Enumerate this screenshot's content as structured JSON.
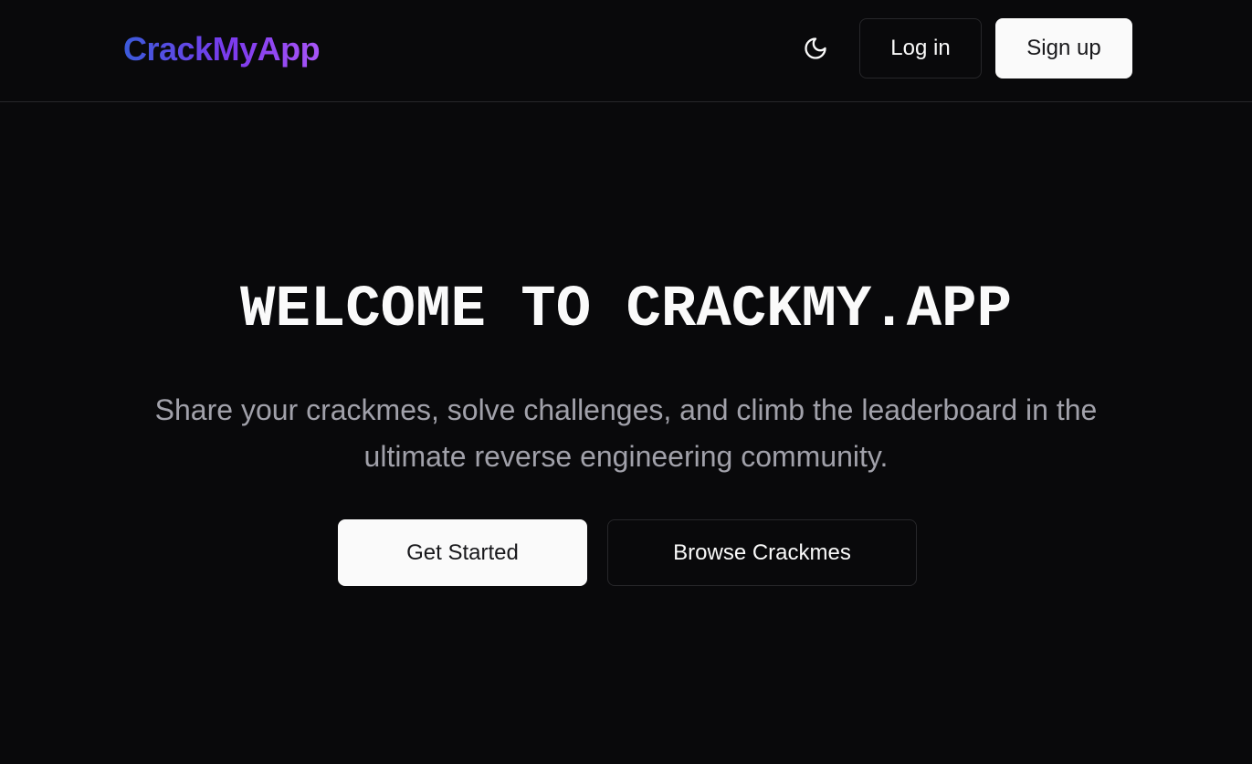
{
  "navbar": {
    "logo_text": "CrackMyApp",
    "theme_toggle_icon": "moon-icon",
    "login_label": "Log in",
    "signup_label": "Sign up"
  },
  "hero": {
    "title": "WELCOME TO CRACKMY.APP",
    "subtitle": "Share your crackmes, solve challenges, and climb the leaderboard in the ultimate reverse engineering community.",
    "primary_button_label": "Get Started",
    "secondary_button_label": "Browse Crackmes"
  },
  "colors": {
    "background": "#09090b",
    "logo_gradient_start": "#3b5bdb",
    "logo_gradient_end": "#a855f7",
    "primary_button_bg": "#fafafa",
    "muted_text": "#a1a1aa",
    "border": "#27272a"
  }
}
